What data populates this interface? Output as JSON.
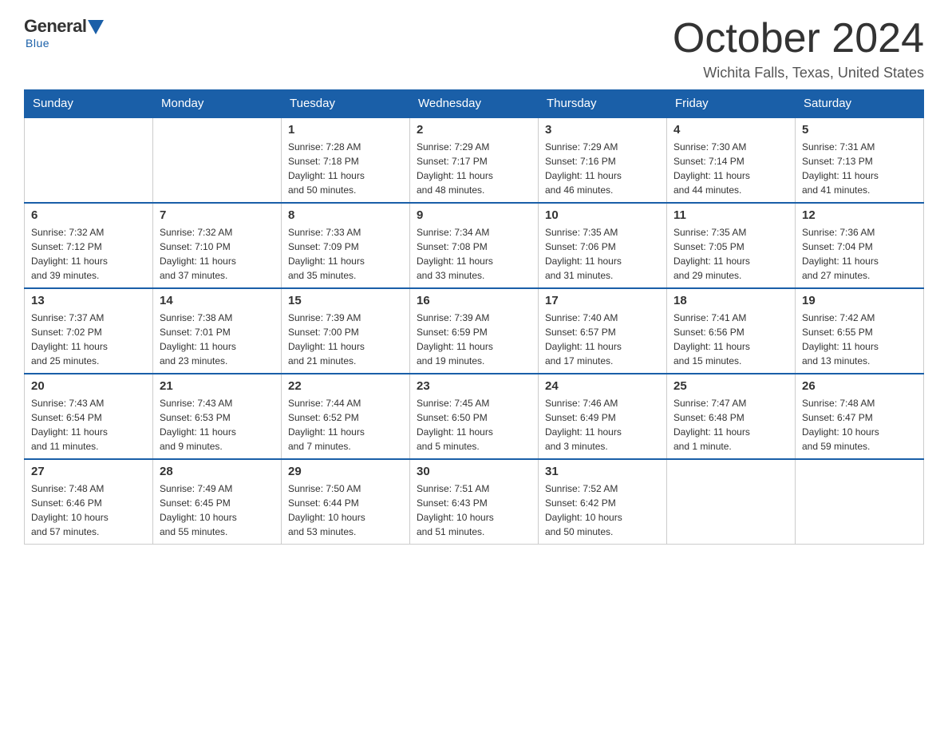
{
  "logo": {
    "general": "General",
    "blue": "Blue",
    "tagline": "Blue"
  },
  "title": "October 2024",
  "subtitle": "Wichita Falls, Texas, United States",
  "days_of_week": [
    "Sunday",
    "Monday",
    "Tuesday",
    "Wednesday",
    "Thursday",
    "Friday",
    "Saturday"
  ],
  "weeks": [
    [
      {
        "day": "",
        "info": ""
      },
      {
        "day": "",
        "info": ""
      },
      {
        "day": "1",
        "info": "Sunrise: 7:28 AM\nSunset: 7:18 PM\nDaylight: 11 hours\nand 50 minutes."
      },
      {
        "day": "2",
        "info": "Sunrise: 7:29 AM\nSunset: 7:17 PM\nDaylight: 11 hours\nand 48 minutes."
      },
      {
        "day": "3",
        "info": "Sunrise: 7:29 AM\nSunset: 7:16 PM\nDaylight: 11 hours\nand 46 minutes."
      },
      {
        "day": "4",
        "info": "Sunrise: 7:30 AM\nSunset: 7:14 PM\nDaylight: 11 hours\nand 44 minutes."
      },
      {
        "day": "5",
        "info": "Sunrise: 7:31 AM\nSunset: 7:13 PM\nDaylight: 11 hours\nand 41 minutes."
      }
    ],
    [
      {
        "day": "6",
        "info": "Sunrise: 7:32 AM\nSunset: 7:12 PM\nDaylight: 11 hours\nand 39 minutes."
      },
      {
        "day": "7",
        "info": "Sunrise: 7:32 AM\nSunset: 7:10 PM\nDaylight: 11 hours\nand 37 minutes."
      },
      {
        "day": "8",
        "info": "Sunrise: 7:33 AM\nSunset: 7:09 PM\nDaylight: 11 hours\nand 35 minutes."
      },
      {
        "day": "9",
        "info": "Sunrise: 7:34 AM\nSunset: 7:08 PM\nDaylight: 11 hours\nand 33 minutes."
      },
      {
        "day": "10",
        "info": "Sunrise: 7:35 AM\nSunset: 7:06 PM\nDaylight: 11 hours\nand 31 minutes."
      },
      {
        "day": "11",
        "info": "Sunrise: 7:35 AM\nSunset: 7:05 PM\nDaylight: 11 hours\nand 29 minutes."
      },
      {
        "day": "12",
        "info": "Sunrise: 7:36 AM\nSunset: 7:04 PM\nDaylight: 11 hours\nand 27 minutes."
      }
    ],
    [
      {
        "day": "13",
        "info": "Sunrise: 7:37 AM\nSunset: 7:02 PM\nDaylight: 11 hours\nand 25 minutes."
      },
      {
        "day": "14",
        "info": "Sunrise: 7:38 AM\nSunset: 7:01 PM\nDaylight: 11 hours\nand 23 minutes."
      },
      {
        "day": "15",
        "info": "Sunrise: 7:39 AM\nSunset: 7:00 PM\nDaylight: 11 hours\nand 21 minutes."
      },
      {
        "day": "16",
        "info": "Sunrise: 7:39 AM\nSunset: 6:59 PM\nDaylight: 11 hours\nand 19 minutes."
      },
      {
        "day": "17",
        "info": "Sunrise: 7:40 AM\nSunset: 6:57 PM\nDaylight: 11 hours\nand 17 minutes."
      },
      {
        "day": "18",
        "info": "Sunrise: 7:41 AM\nSunset: 6:56 PM\nDaylight: 11 hours\nand 15 minutes."
      },
      {
        "day": "19",
        "info": "Sunrise: 7:42 AM\nSunset: 6:55 PM\nDaylight: 11 hours\nand 13 minutes."
      }
    ],
    [
      {
        "day": "20",
        "info": "Sunrise: 7:43 AM\nSunset: 6:54 PM\nDaylight: 11 hours\nand 11 minutes."
      },
      {
        "day": "21",
        "info": "Sunrise: 7:43 AM\nSunset: 6:53 PM\nDaylight: 11 hours\nand 9 minutes."
      },
      {
        "day": "22",
        "info": "Sunrise: 7:44 AM\nSunset: 6:52 PM\nDaylight: 11 hours\nand 7 minutes."
      },
      {
        "day": "23",
        "info": "Sunrise: 7:45 AM\nSunset: 6:50 PM\nDaylight: 11 hours\nand 5 minutes."
      },
      {
        "day": "24",
        "info": "Sunrise: 7:46 AM\nSunset: 6:49 PM\nDaylight: 11 hours\nand 3 minutes."
      },
      {
        "day": "25",
        "info": "Sunrise: 7:47 AM\nSunset: 6:48 PM\nDaylight: 11 hours\nand 1 minute."
      },
      {
        "day": "26",
        "info": "Sunrise: 7:48 AM\nSunset: 6:47 PM\nDaylight: 10 hours\nand 59 minutes."
      }
    ],
    [
      {
        "day": "27",
        "info": "Sunrise: 7:48 AM\nSunset: 6:46 PM\nDaylight: 10 hours\nand 57 minutes."
      },
      {
        "day": "28",
        "info": "Sunrise: 7:49 AM\nSunset: 6:45 PM\nDaylight: 10 hours\nand 55 minutes."
      },
      {
        "day": "29",
        "info": "Sunrise: 7:50 AM\nSunset: 6:44 PM\nDaylight: 10 hours\nand 53 minutes."
      },
      {
        "day": "30",
        "info": "Sunrise: 7:51 AM\nSunset: 6:43 PM\nDaylight: 10 hours\nand 51 minutes."
      },
      {
        "day": "31",
        "info": "Sunrise: 7:52 AM\nSunset: 6:42 PM\nDaylight: 10 hours\nand 50 minutes."
      },
      {
        "day": "",
        "info": ""
      },
      {
        "day": "",
        "info": ""
      }
    ]
  ]
}
